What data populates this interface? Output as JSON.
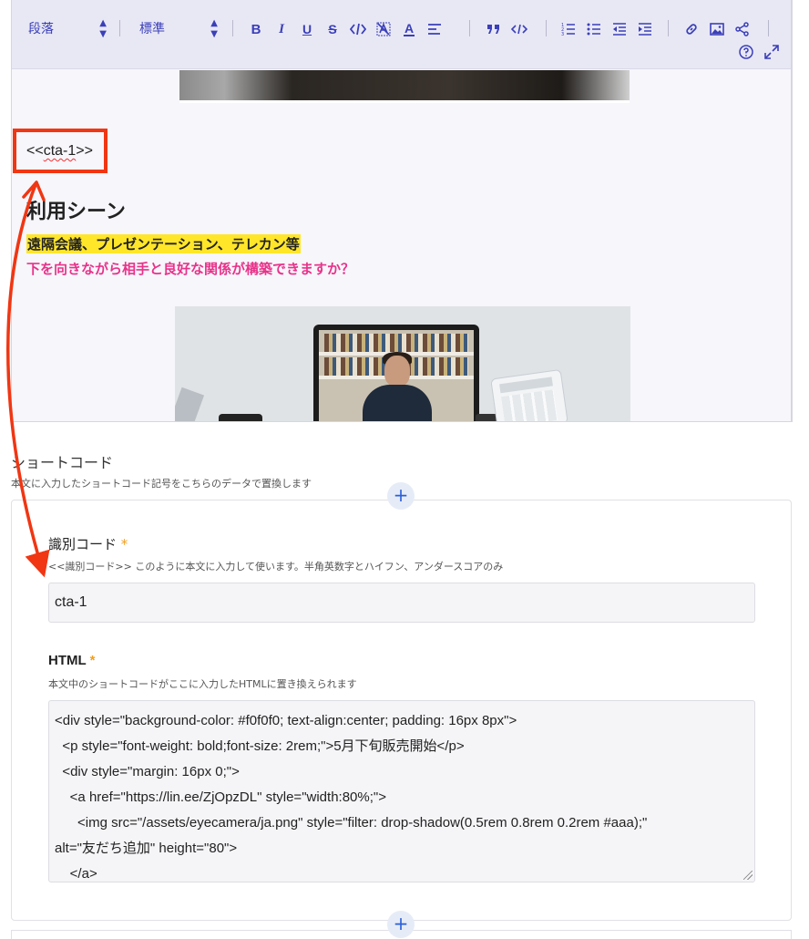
{
  "toolbar": {
    "block_format": "段落",
    "font_size": "標準",
    "buttons": [
      "bold-icon",
      "italic-icon",
      "underline-icon",
      "strikethrough-icon",
      "code-inline-icon",
      "clear-format-icon",
      "font-color-icon",
      "align-icon",
      "quote-icon",
      "code-block-icon",
      "ordered-list-icon",
      "bullet-list-icon",
      "outdent-icon",
      "indent-icon",
      "link-icon",
      "image-icon",
      "share-icon",
      "help-icon",
      "fullscreen-icon"
    ],
    "bold_glyph": "B",
    "italic_glyph": "I",
    "underline_glyph": "U",
    "strike_glyph": "S",
    "color_glyph": "A"
  },
  "editor": {
    "cta_prefix": "<<",
    "cta_code": "cta-1",
    "cta_suffix": ">>",
    "heading": "利用シーン",
    "highlight": "遠隔会議、プレゼンテーション、テレカン等",
    "question": "下を向きながら相手と良好な関係が構築できますか？"
  },
  "shortcode": {
    "title": "ショートコード",
    "description": "本文に入力したショートコード記号をこちらのデータで置換します",
    "add_label": "+",
    "id_label": "識別コード",
    "required_mark": "*",
    "id_help": "<<識別コード>> このように本文に入力して使います。半角英数字とハイフン、アンダースコアのみ",
    "id_value": "cta-1",
    "html_label": "HTML",
    "html_help": "本文中のショートコードがここに入力したHTMLに置き換えられます",
    "html_lines": [
      "<div style=\"background-color: #f0f0f0; text-align:center; padding: 16px 8px\">",
      "  <p style=\"font-weight: bold;font-size: 2rem;\">5月下旬販売開始</p>",
      "  <div style=\"margin: 16px 0;\">",
      "    <a href=\"https://lin.ee/ZjOpzDL\" style=\"width:80%;\">",
      "      <img src=\"/assets/eyecamera/ja.png\" style=\"filter: drop-shadow(0.5rem 0.8rem 0.2rem #aaa);\"",
      "alt=\"友だち追加\" height=\"80\">",
      "    </a>"
    ]
  },
  "colors": {
    "toolbar_accent": "#3b3fb8",
    "annotation_red": "#f03613",
    "highlight_yellow": "#ffe629",
    "question_pink": "#e8338a",
    "required_orange": "#f0a020",
    "plus_blue": "#2b5fd9"
  }
}
